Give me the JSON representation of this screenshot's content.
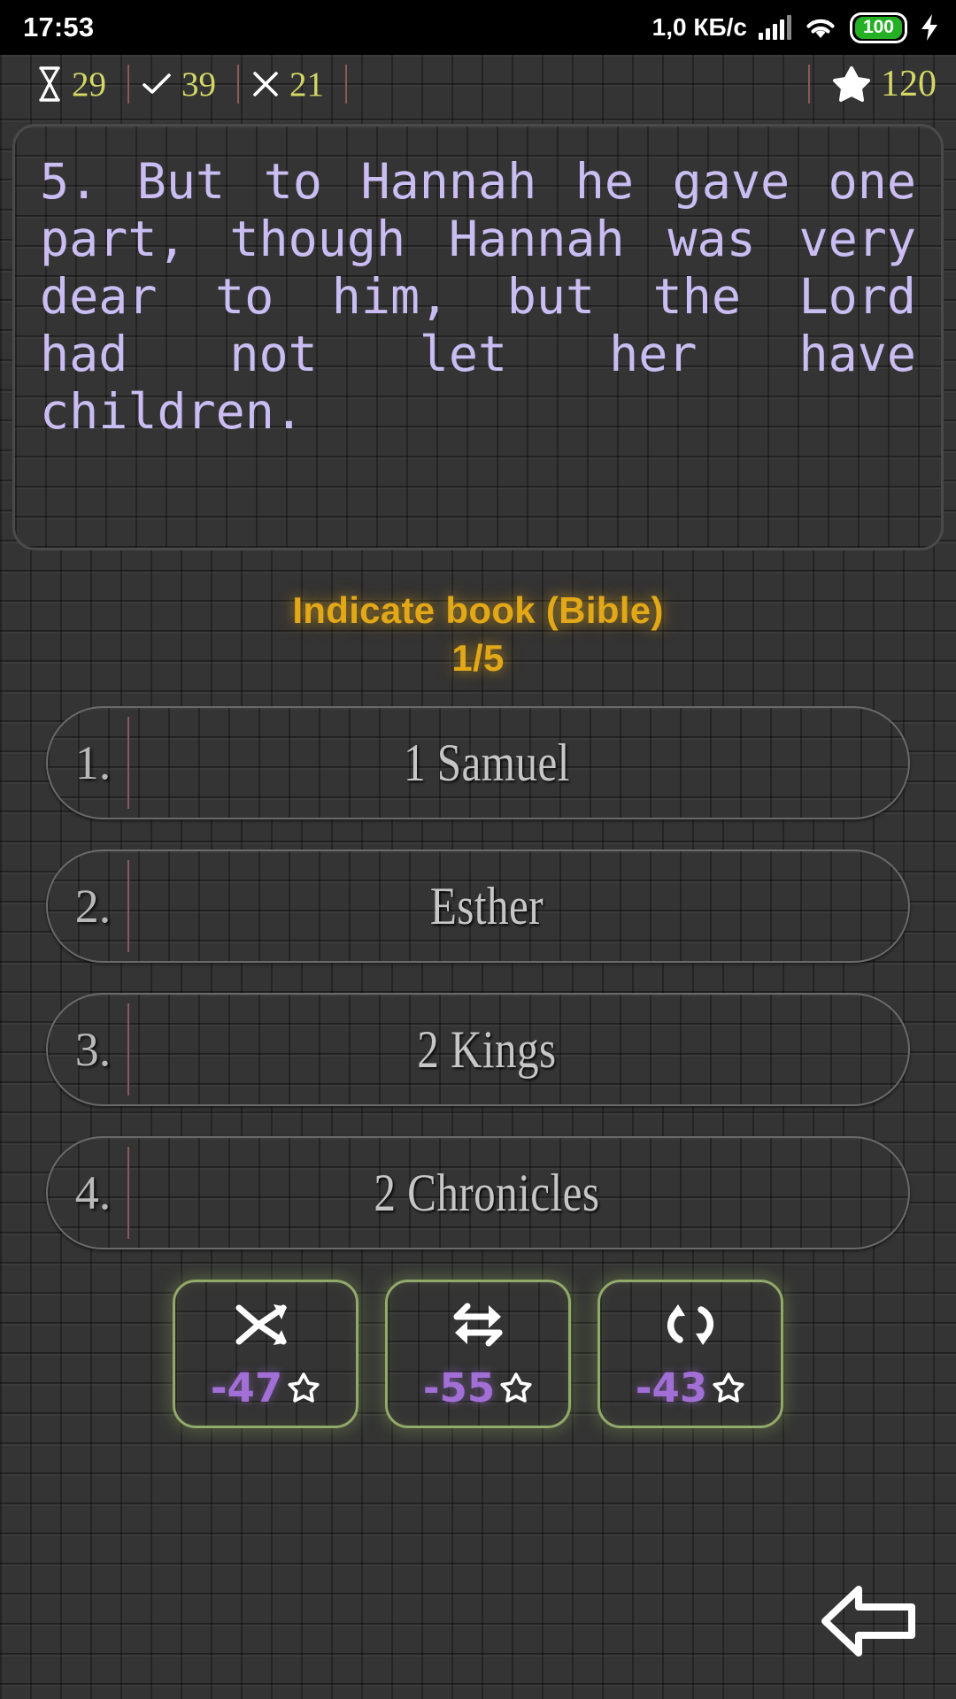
{
  "status_bar": {
    "time": "17:53",
    "net_speed": "1,0 КБ/с",
    "battery_level": "100",
    "icons": [
      "signal-bars-icon",
      "wifi-icon",
      "battery-icon",
      "charging-bolt-icon"
    ]
  },
  "game_header": {
    "timer": {
      "icon": "hourglass-icon",
      "value": "29"
    },
    "correct": {
      "icon": "check-icon",
      "value": "39"
    },
    "wrong": {
      "icon": "cross-icon",
      "value": "21"
    },
    "score": {
      "icon": "star-icon",
      "value": "120"
    },
    "accent_color": "#d2d766",
    "divider_color": "#9c5f5f"
  },
  "question": {
    "text": "5. But to Hannah he gave one part, though Hannah was very dear to him, but the Lord had not let her have children.",
    "text_color": "#c9bdf2"
  },
  "prompt": {
    "title": "Indicate book (Bible)",
    "counter": "1/5",
    "color": "#e3a817"
  },
  "answers": [
    {
      "num": "1.",
      "label": "1 Samuel"
    },
    {
      "num": "2.",
      "label": "Esther"
    },
    {
      "num": "3.",
      "label": "2 Kings"
    },
    {
      "num": "4.",
      "label": "2 Chronicles"
    }
  ],
  "powerups": [
    {
      "icon": "shuffle-icon",
      "cost": "-47",
      "currency_icon": "star-icon"
    },
    {
      "icon": "swap-icon",
      "cost": "-55",
      "currency_icon": "star-icon"
    },
    {
      "icon": "refresh-icon",
      "cost": "-43",
      "currency_icon": "star-icon"
    }
  ],
  "navigation": {
    "back_icon": "back-arrow-icon"
  },
  "colors": {
    "powerup_border": "#93a96a",
    "powerup_cost": "#a26fd6",
    "answer_text": "#c6c6c6"
  }
}
